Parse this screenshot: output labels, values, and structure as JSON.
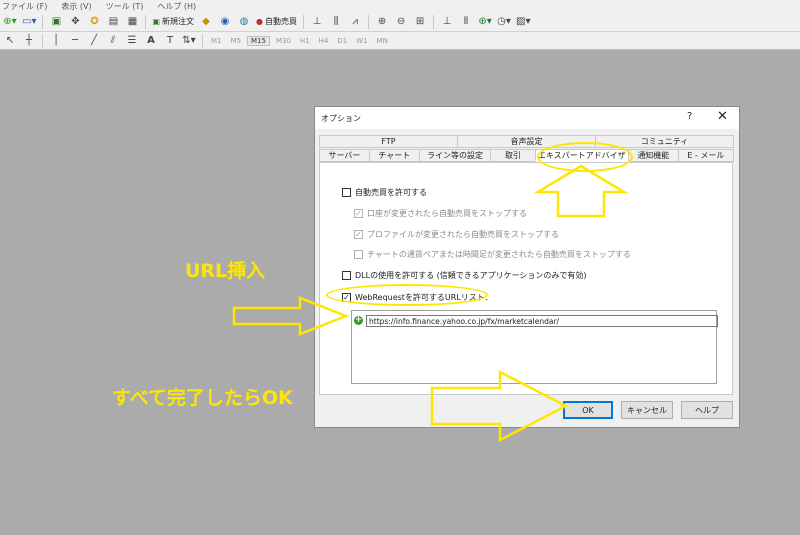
{
  "menubar": {
    "items": [
      "ファイル (F)",
      "表示 (V)",
      "ツール (T)",
      "ヘルプ (H)"
    ]
  },
  "toolbar": {
    "new_order_label": "新規注文",
    "auto_trade_label": "自動売買"
  },
  "timeframes": [
    "M1",
    "M5",
    "M15",
    "M30",
    "H1",
    "H4",
    "D1",
    "W1",
    "MN"
  ],
  "active_timeframe": "M15",
  "dialog": {
    "title": "オプション",
    "help": "?",
    "close": "✕",
    "tabs_row1": [
      "FTP",
      "音声設定",
      "コミュニティ"
    ],
    "tabs_row2": [
      "サーバー",
      "チャート",
      "ライン等の設定",
      "取引",
      "エキスパートアドバイザ",
      "通知機能",
      "E - メール"
    ],
    "active_tab": "エキスパートアドバイザ",
    "options": [
      {
        "label": "自動売買を許可する",
        "checked": false,
        "enabled": true
      },
      {
        "label": "口座が変更されたら自動売買をストップする",
        "checked": true,
        "enabled": false
      },
      {
        "label": "プロファイルが変更されたら自動売買をストップする",
        "checked": true,
        "enabled": false
      },
      {
        "label": "チャートの通貨ペアまたは時間足が変更されたら自動売買をストップする",
        "checked": false,
        "enabled": false
      },
      {
        "label": "DLLの使用を許可する (信頼できるアプリケーションのみで有効)",
        "checked": false,
        "enabled": true
      },
      {
        "label": "WebRequestを許可するURLリスト：",
        "checked": true,
        "enabled": true
      }
    ],
    "url_list": [
      "https://info.finance.yahoo.co.jp/fx/marketcalendar/"
    ],
    "buttons": {
      "ok": "OK",
      "cancel": "キャンセル",
      "help": "ヘルプ"
    }
  },
  "annotations": {
    "url_insert": "URL挿入",
    "done_ok": "すべて完了したらOK"
  },
  "colors": {
    "annotation": "#ffe600",
    "background": "#ababab",
    "ok_border": "#0078d7"
  }
}
